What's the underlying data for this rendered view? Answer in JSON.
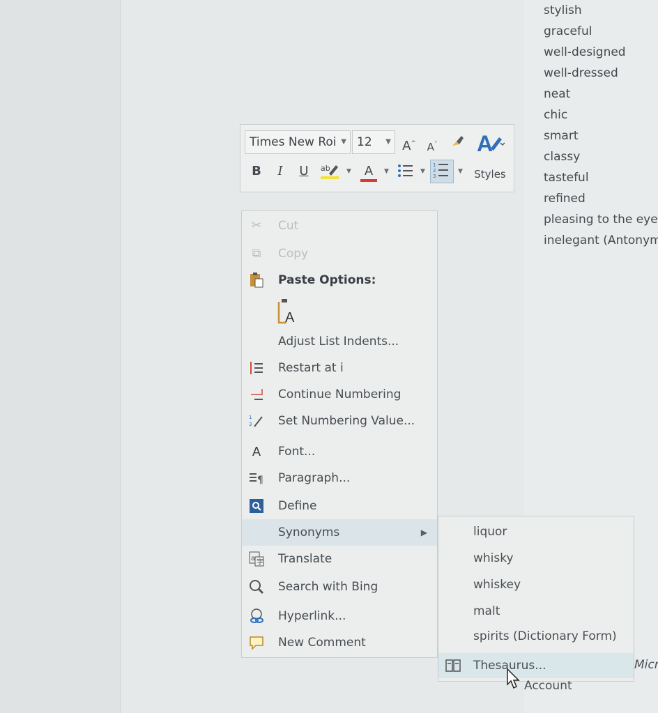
{
  "mini_toolbar": {
    "font_name": "Times New Roi",
    "font_size": "12",
    "grow_font": "A",
    "shrink_font": "A",
    "styles_label": "Styles",
    "bold": "B",
    "italic": "I",
    "underline": "U",
    "font_color": "A"
  },
  "context_menu": {
    "items": [
      {
        "label": "Cut",
        "icon": "scissors-icon"
      },
      {
        "label": "Copy",
        "icon": "copy-icon"
      },
      {
        "label": "Paste Options:",
        "icon": "paste-icon"
      },
      {
        "label": "A",
        "icon": "keep-text-only-icon"
      },
      {
        "label": "Adjust List Indents..."
      },
      {
        "label": "Restart at i",
        "icon": "restart-numbering-icon"
      },
      {
        "label": "Continue Numbering",
        "icon": "continue-numbering-icon"
      },
      {
        "label": "Set Numbering Value...",
        "icon": "set-numbering-value-icon"
      },
      {
        "label": "Font...",
        "icon": "font-icon"
      },
      {
        "label": "Paragraph...",
        "icon": "paragraph-icon"
      },
      {
        "label": "Define",
        "icon": "define-icon"
      },
      {
        "label": "Synonyms"
      },
      {
        "label": "Translate",
        "icon": "translate-icon"
      },
      {
        "label": "Search with Bing",
        "icon": "search-icon"
      },
      {
        "label": "Hyperlink...",
        "icon": "hyperlink-icon"
      },
      {
        "label": "New Comment",
        "icon": "comment-icon"
      }
    ]
  },
  "synonyms_submenu": {
    "items": [
      "liquor",
      "whisky",
      "whiskey",
      "malt",
      "spirits (Dictionary Form)",
      "Thesaurus..."
    ]
  },
  "thesaurus_pane": {
    "words": [
      "stylish",
      "graceful",
      "well-designed",
      "well-dressed",
      "neat",
      "chic",
      "smart",
      "classy",
      "tasteful",
      "refined",
      "pleasing to the eye (I",
      "inelegant (Antonym)"
    ]
  },
  "behind": {
    "micro": "Micro",
    "account": "Account"
  }
}
